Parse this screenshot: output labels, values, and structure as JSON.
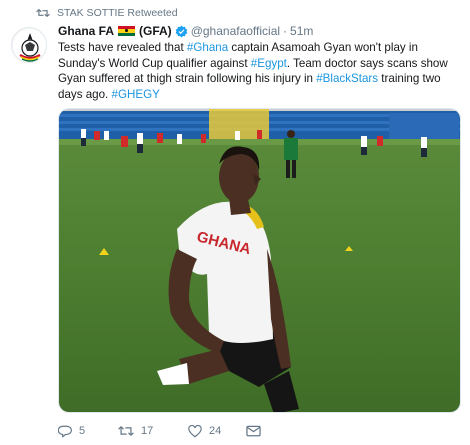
{
  "retweet": {
    "label": "STAK SOTTIE Retweeted"
  },
  "author": {
    "name": "Ghana FA",
    "name_suffix": "(GFA)",
    "handle": "@ghanafaofficial",
    "separator": "·",
    "time": "51m",
    "avatar_icon": "ghana-fa-logo",
    "flag_colors": [
      "#ce1126",
      "#fcd116",
      "#006b3f"
    ]
  },
  "tweet": {
    "t1": "Tests have revealed that ",
    "h1": "#Ghana",
    "t2": "  captain Asamoah Gyan won't play in Sunday's World Cup qualifier against ",
    "h2": "#Egypt",
    "t3": ". Team doctor says scans show Gyan suffered at thigh strain following his injury in ",
    "h3": "#BlackStars",
    "t4": " training two days ago. ",
    "h4": "#GHEGY"
  },
  "photo": {
    "jersey_text": "GHANA"
  },
  "actions": {
    "reply_icon": "reply-icon",
    "reply_count": "5",
    "retweet_icon": "retweet-icon",
    "retweet_count": "17",
    "like_icon": "heart-icon",
    "like_count": "24",
    "dm_icon": "envelope-icon"
  },
  "colors": {
    "link": "#1b95e0",
    "muted": "#657786",
    "verified": "#1da1f2"
  }
}
